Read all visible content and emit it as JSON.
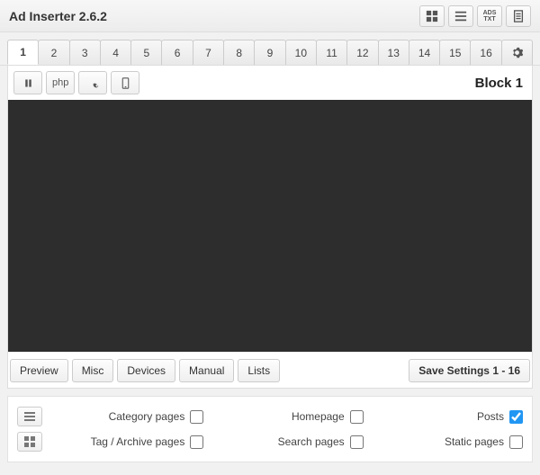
{
  "topbar": {
    "title": "Ad Inserter 2.6.2"
  },
  "tabs": [
    "1",
    "2",
    "3",
    "4",
    "5",
    "6",
    "7",
    "8",
    "9",
    "10",
    "11",
    "12",
    "13",
    "14",
    "15",
    "16"
  ],
  "active_tab": 0,
  "toolbar": {
    "php_label": "php"
  },
  "block": {
    "title": "Block 1"
  },
  "buttons": {
    "preview": "Preview",
    "misc": "Misc",
    "devices": "Devices",
    "manual": "Manual",
    "lists": "Lists",
    "save": "Save Settings 1 - 16"
  },
  "checks": {
    "row1": [
      {
        "label": "Category pages",
        "checked": false
      },
      {
        "label": "Homepage",
        "checked": false
      },
      {
        "label": "Posts",
        "checked": true
      }
    ],
    "row2": [
      {
        "label": "Tag / Archive pages",
        "checked": false
      },
      {
        "label": "Search pages",
        "checked": false
      },
      {
        "label": "Static pages",
        "checked": false
      }
    ]
  }
}
